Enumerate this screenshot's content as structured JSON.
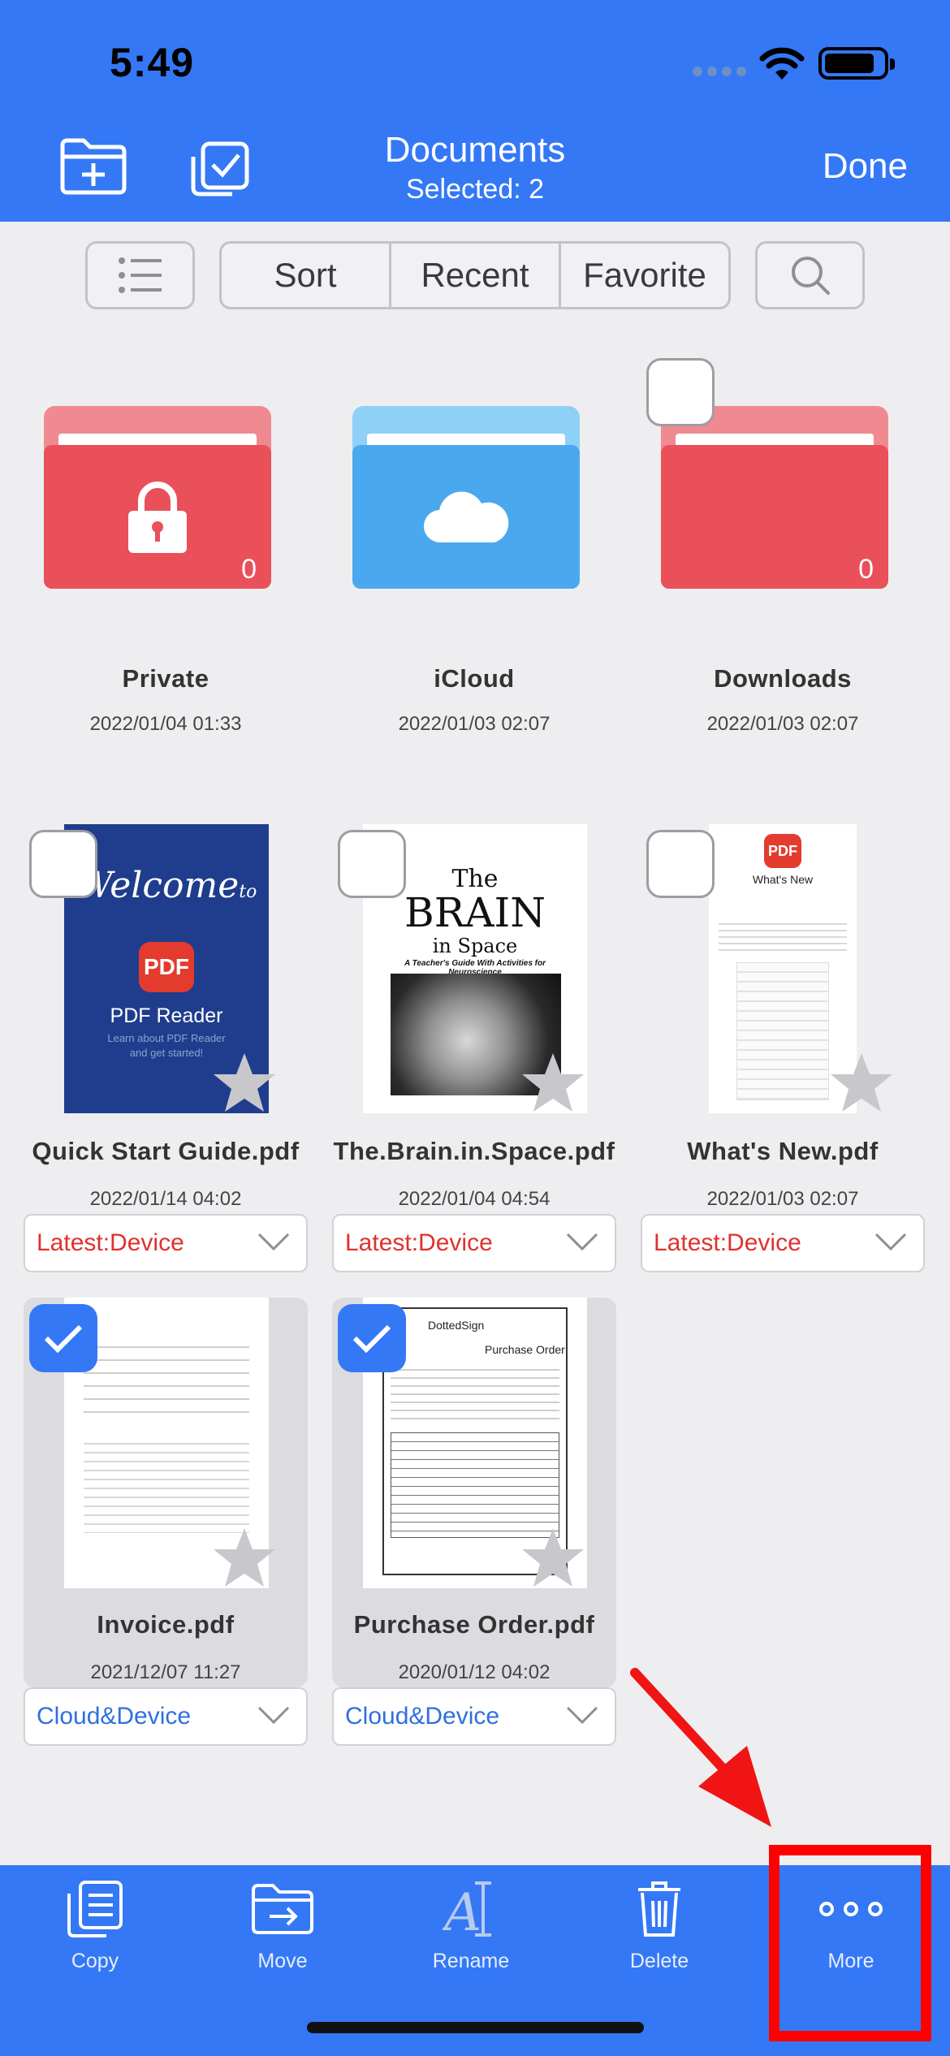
{
  "status": {
    "time": "5:49"
  },
  "header": {
    "title": "Documents",
    "subtitle": "Selected: 2",
    "done_label": "Done"
  },
  "toolbar": {
    "segments": [
      "Sort",
      "Recent",
      "Favorite"
    ]
  },
  "folders": [
    {
      "name": "Private",
      "date": "2022/01/04 01:33",
      "count": "0",
      "color": "#e9505a",
      "icon": "lock-icon"
    },
    {
      "name": "iCloud",
      "date": "2022/01/03 02:07",
      "count": "",
      "color": "#4aa8ee",
      "icon": "cloud-icon"
    },
    {
      "name": "Downloads",
      "date": "2022/01/03 02:07",
      "count": "0",
      "color": "#e9505a",
      "icon": ""
    }
  ],
  "files": [
    {
      "name": "Quick Start Guide.pdf",
      "date": "2022/01/14 04:02",
      "source": "Latest:Device",
      "selected": false,
      "thumb": {
        "line1": "Welcome",
        "line2": "to",
        "badge": "PDF",
        "title": "PDF Reader",
        "sub1": "Learn about PDF Reader",
        "sub2": "and get started!"
      }
    },
    {
      "name": "The.Brain.in.Space.pdf",
      "date": "2022/01/04 04:54",
      "source": "Latest:Device",
      "selected": false,
      "thumb": {
        "line1": "The",
        "line2": "BRAIN",
        "line3": "in Space",
        "sub": "A Teacher's Guide With Activities for Neuroscience"
      }
    },
    {
      "name": "What's New.pdf",
      "date": "2022/01/03 02:07",
      "source": "Latest:Device",
      "selected": false,
      "thumb": {
        "badge": "PDF",
        "title": "What's New"
      }
    },
    {
      "name": "Invoice.pdf",
      "date": "2021/12/07 11:27",
      "source": "Cloud&Device",
      "selected": true,
      "thumb": {
        "title": ""
      }
    },
    {
      "name": "Purchase Order.pdf",
      "date": "2020/01/12 04:02",
      "source": "Cloud&Device",
      "selected": true,
      "thumb": {
        "brand": "DottedSign",
        "title": "Purchase Order"
      }
    }
  ],
  "bottombar": [
    {
      "label": "Copy",
      "icon": "copy-icon"
    },
    {
      "label": "Move",
      "icon": "move-icon"
    },
    {
      "label": "Rename",
      "icon": "rename-icon"
    },
    {
      "label": "Delete",
      "icon": "trash-icon"
    },
    {
      "label": "More",
      "icon": "more-icon"
    }
  ],
  "colors": {
    "accent": "#3478f6",
    "latest": "#e0312c",
    "cloud": "#2f6fe0",
    "highlight": "#ff0000"
  }
}
